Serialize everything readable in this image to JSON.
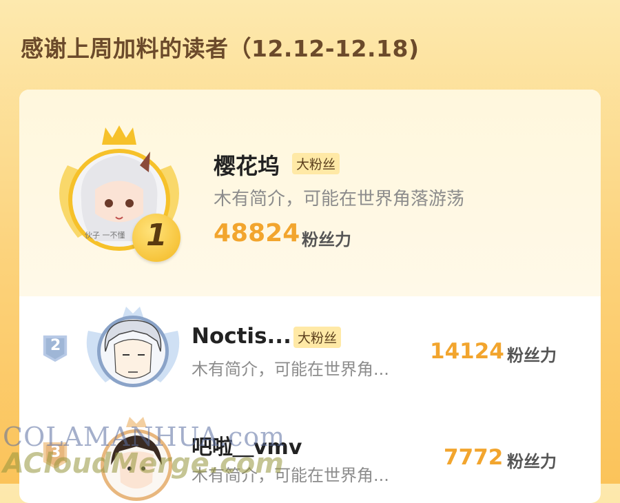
{
  "header": {
    "title": "感谢上周加料的读者（12.12-12.18)"
  },
  "readers": [
    {
      "rank": "1",
      "name": "樱花坞",
      "badge": "大粉丝",
      "bio": "木有简介，可能在世界角落游荡",
      "score": "48824",
      "score_unit": "粉丝力",
      "avatar_text": "伙子 一不懂"
    },
    {
      "rank": "2",
      "name": "Noctis...",
      "badge": "大粉丝",
      "bio": "木有简介，可能在世界角...",
      "score": "14124",
      "score_unit": "粉丝力"
    },
    {
      "rank": "3",
      "name": "吧啦＿vmv",
      "bio": "木有简介，可能在世界角...",
      "score": "7772",
      "score_unit": "粉丝力"
    }
  ],
  "watermark": {
    "line1": "COLAMANHUA.com",
    "line2": "ACloudMerge.com"
  },
  "colors": {
    "accent": "#f2a52e",
    "gold": "#f6c12a",
    "silver": "#9fb6d6"
  }
}
